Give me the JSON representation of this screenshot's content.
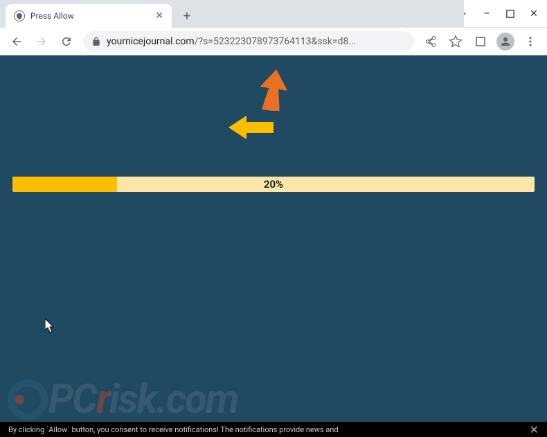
{
  "window": {
    "minimize": "–",
    "maximize": "▢",
    "close": "✕"
  },
  "tab": {
    "title": "Press Allow",
    "close": "✕",
    "new": "+"
  },
  "address": {
    "domain": "yournicejournal.com",
    "path": "/?s=523223078973764113&ssk=d8..."
  },
  "progress": {
    "percent": 20,
    "label": "20%"
  },
  "watermark": {
    "p": "P",
    "c": "C",
    "r": "r",
    "rest": "isk.com"
  },
  "bottom": {
    "text": "By clicking `Allow` button, you consent to receive notifications! The notifications provide news and",
    "close": "✕"
  },
  "arrows": {
    "orange": "#e87022",
    "yellow": "#fdbe00"
  }
}
